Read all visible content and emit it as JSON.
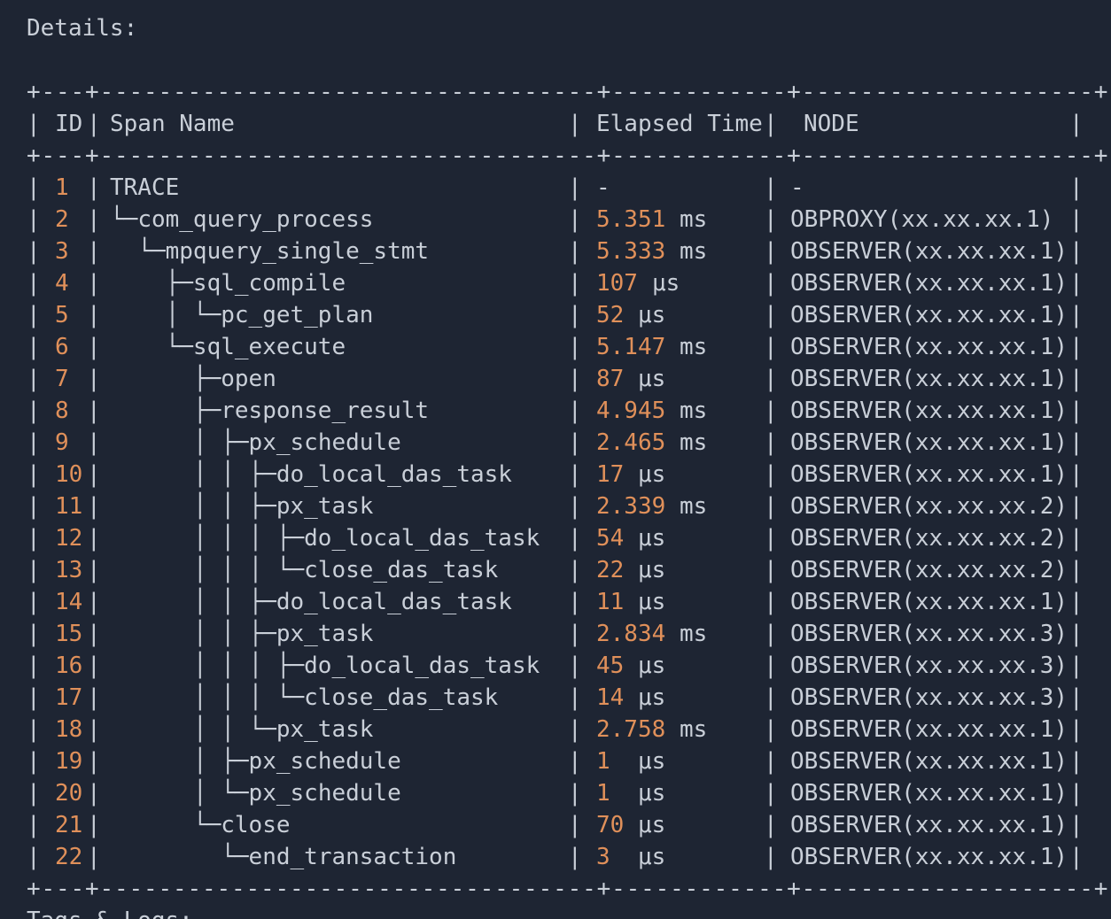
{
  "section_title": "Details:",
  "next_section_title": "Tags & Logs:",
  "table": {
    "border": "+---+----------------------------------+------------+--------------------+",
    "headers": {
      "id": "ID",
      "span_name": "Span Name",
      "elapsed_time": "Elapsed Time",
      "node": "NODE"
    },
    "rows": [
      {
        "id": "1",
        "prefix": "",
        "name": "TRACE",
        "value": "-",
        "unit": "",
        "node": "-"
      },
      {
        "id": "2",
        "prefix": "└─",
        "name": "com_query_process",
        "value": "5.351",
        "unit": "ms",
        "node": "OBPROXY(xx.xx.xx.1)"
      },
      {
        "id": "3",
        "prefix": "  └─",
        "name": "mpquery_single_stmt",
        "value": "5.333",
        "unit": "ms",
        "node": "OBSERVER(xx.xx.xx.1)"
      },
      {
        "id": "4",
        "prefix": "    ├─",
        "name": "sql_compile",
        "value": "107",
        "unit": "μs",
        "node": "OBSERVER(xx.xx.xx.1)"
      },
      {
        "id": "5",
        "prefix": "    │ └─",
        "name": "pc_get_plan",
        "value": "52",
        "unit": "μs",
        "node": "OBSERVER(xx.xx.xx.1)"
      },
      {
        "id": "6",
        "prefix": "    └─",
        "name": "sql_execute",
        "value": "5.147",
        "unit": "ms",
        "node": "OBSERVER(xx.xx.xx.1)"
      },
      {
        "id": "7",
        "prefix": "      ├─",
        "name": "open",
        "value": "87",
        "unit": "μs",
        "node": "OBSERVER(xx.xx.xx.1)"
      },
      {
        "id": "8",
        "prefix": "      ├─",
        "name": "response_result",
        "value": "4.945",
        "unit": "ms",
        "node": "OBSERVER(xx.xx.xx.1)"
      },
      {
        "id": "9",
        "prefix": "      │ ├─",
        "name": "px_schedule",
        "value": "2.465",
        "unit": "ms",
        "node": "OBSERVER(xx.xx.xx.1)"
      },
      {
        "id": "10",
        "prefix": "      │ │ ├─",
        "name": "do_local_das_task",
        "value": "17",
        "unit": "μs",
        "node": "OBSERVER(xx.xx.xx.1)"
      },
      {
        "id": "11",
        "prefix": "      │ │ ├─",
        "name": "px_task",
        "value": "2.339",
        "unit": "ms",
        "node": "OBSERVER(xx.xx.xx.2)"
      },
      {
        "id": "12",
        "prefix": "      │ │ │ ├─",
        "name": "do_local_das_task",
        "value": "54",
        "unit": "μs",
        "node": "OBSERVER(xx.xx.xx.2)"
      },
      {
        "id": "13",
        "prefix": "      │ │ │ └─",
        "name": "close_das_task",
        "value": "22",
        "unit": "μs",
        "node": "OBSERVER(xx.xx.xx.2)"
      },
      {
        "id": "14",
        "prefix": "      │ │ ├─",
        "name": "do_local_das_task",
        "value": "11",
        "unit": "μs",
        "node": "OBSERVER(xx.xx.xx.1)"
      },
      {
        "id": "15",
        "prefix": "      │ │ ├─",
        "name": "px_task",
        "value": "2.834",
        "unit": "ms",
        "node": "OBSERVER(xx.xx.xx.3)"
      },
      {
        "id": "16",
        "prefix": "      │ │ │ ├─",
        "name": "do_local_das_task",
        "value": "45",
        "unit": "μs",
        "node": "OBSERVER(xx.xx.xx.3)"
      },
      {
        "id": "17",
        "prefix": "      │ │ │ └─",
        "name": "close_das_task",
        "value": "14",
        "unit": "μs",
        "node": "OBSERVER(xx.xx.xx.3)"
      },
      {
        "id": "18",
        "prefix": "      │ │ └─",
        "name": "px_task",
        "value": "2.758",
        "unit": "ms",
        "node": "OBSERVER(xx.xx.xx.1)"
      },
      {
        "id": "19",
        "prefix": "      │ ├─",
        "name": "px_schedule",
        "value": "1",
        "unit": "μs",
        "node": "OBSERVER(xx.xx.xx.1)"
      },
      {
        "id": "20",
        "prefix": "      │ └─",
        "name": "px_schedule",
        "value": "1",
        "unit": "μs",
        "node": "OBSERVER(xx.xx.xx.1)"
      },
      {
        "id": "21",
        "prefix": "      └─",
        "name": "close",
        "value": "70",
        "unit": "μs",
        "node": "OBSERVER(xx.xx.xx.1)"
      },
      {
        "id": "22",
        "prefix": "        └─",
        "name": "end_transaction",
        "value": "3",
        "unit": "μs",
        "node": "OBSERVER(xx.xx.xx.1)"
      }
    ]
  },
  "colors": {
    "background": "#1e2533",
    "text": "#c9cfd8",
    "number": "#e0905a"
  }
}
